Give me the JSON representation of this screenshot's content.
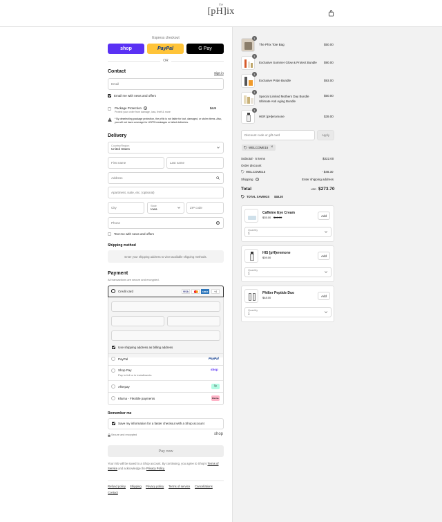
{
  "header": {
    "logo_small": "the",
    "logo_main": "[pH]ix",
    "bag_icon": "shopping-bag-icon"
  },
  "express": {
    "label": "Express checkout",
    "shop": "shop",
    "paypal": "PayPal",
    "gpay": "G Pay",
    "or": "OR"
  },
  "contact": {
    "title": "Contact",
    "signin": "Sign in",
    "email_placeholder": "Email",
    "email_news": "Email me with news and offers",
    "protection_title": "Package Protection",
    "protection_sub": "Protect your order from damage, loss, theft & more",
    "protection_price": "$4.9",
    "warning": "* By deselecting package protection, the pHix is not liable for lost, damaged, or stolen items. Also, you will not have coverage for USPS breakages or failed deliveries."
  },
  "delivery": {
    "title": "Delivery",
    "country_label": "Country/Region",
    "country_value": "United States",
    "first_name": "First name",
    "last_name": "Last name",
    "address": "Address",
    "apartment": "Apartment, suite, etc. (optional)",
    "city": "City",
    "state_label": "State",
    "state_value": "Iowa",
    "zip": "ZIP code",
    "phone": "Phone",
    "text_news": "Text me with news and offers",
    "shipping_method": "Shipping method",
    "shipping_note": "Enter your shipping address to view available shipping methods."
  },
  "payment": {
    "title": "Payment",
    "subtitle": "All transactions are secure and encrypted.",
    "credit_card": "Credit card",
    "card_brands": [
      "VISA",
      "MC",
      "AMEX",
      "+4"
    ],
    "billing_same": "Use shipping address as billing address",
    "options": [
      {
        "label": "PayPal",
        "sub": "",
        "badge": "PayPal"
      },
      {
        "label": "Shop Pay",
        "sub": "Pay in full or in installments",
        "badge": "shop"
      },
      {
        "label": "Afterpay",
        "sub": "",
        "badge": "↻"
      },
      {
        "label": "Klarna - Flexible payments",
        "sub": "",
        "badge": "Klarna."
      }
    ]
  },
  "remember": {
    "title": "Remember me",
    "save_info": "Save my information for a faster checkout with a Shop account",
    "secure": "Secure and encrypted",
    "shop": "shop"
  },
  "pay_now": "Pay now",
  "legal": {
    "line1": "Your info will be saved to a Shop account. By continuing, you agree to Shop's",
    "terms": "Terms of Service",
    "and": "and acknowledge the",
    "privacy": "Privacy Policy."
  },
  "footer_links": [
    "Refund policy",
    "Shipping",
    "Privacy policy",
    "Terms of service",
    "Cancellations",
    "Contact"
  ],
  "cart": {
    "items": [
      {
        "qty": "1",
        "name": "The Phix Tote Bag",
        "price": "$50.00"
      },
      {
        "qty": "1",
        "name": "Exclusive Summer Glow & Protect Bundle",
        "price": "$90.00"
      },
      {
        "qty": "1",
        "name": "Exclusive Pride Bundle",
        "price": "$93.00"
      },
      {
        "qty": "1",
        "name": "Special Limited Mothers Day Bundle Ultimate Anti Aging Bundle",
        "price": "$50.00"
      },
      {
        "qty": "1",
        "name": "HER [pH]eromone",
        "price": "$39.00"
      }
    ],
    "discount_placeholder": "Discount code or gift card",
    "apply": "Apply",
    "code_tag": "WELCOME15",
    "subtotal_label": "Subtotal · 5 items",
    "subtotal": "$322.00",
    "order_discount": "Order discount",
    "discount_code": "WELCOME15",
    "discount_amount": "- $48.30",
    "shipping_label": "Shipping",
    "shipping_value": "Enter shipping address",
    "total_label": "Total",
    "currency": "USD",
    "total": "$273.70",
    "savings_label": "TOTAL SAVINGS",
    "savings": "$48.30"
  },
  "upsells": [
    {
      "name": "Caffeine Eye Cream",
      "price": "$35.00",
      "old_price": "$46.00",
      "add": "Add",
      "qty_label": "Quantity",
      "qty": "1"
    },
    {
      "name": "HIS [pH]eremone",
      "price": "$39.00",
      "old_price": "",
      "add": "Add",
      "qty_label": "Quantity",
      "qty": "1"
    },
    {
      "name": "Philter Peptide Duo",
      "price": "$48.00",
      "old_price": "",
      "add": "Add",
      "qty_label": "Quantity",
      "qty": "1"
    }
  ],
  "colors": {
    "shop": "#5a31f4",
    "paypal": "#ffc439",
    "gpay": "#000000",
    "afterpay": "#b2fce4",
    "klarna": "#ffb3c7"
  }
}
